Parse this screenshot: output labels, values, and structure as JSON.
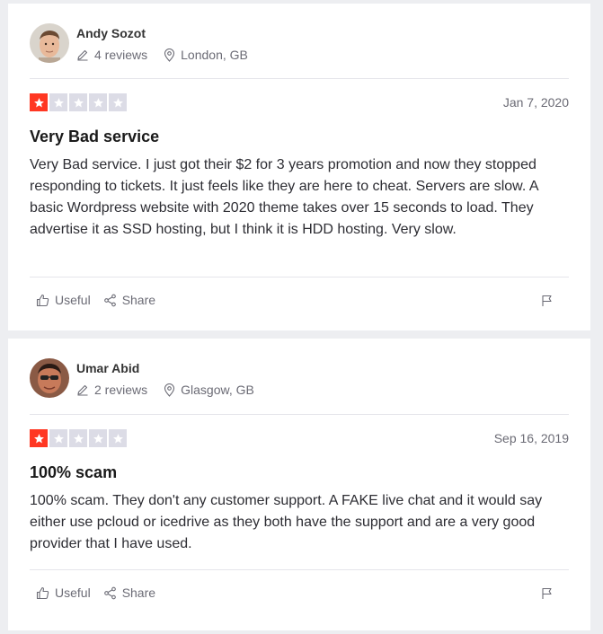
{
  "reviews": [
    {
      "author": "Andy Sozot",
      "review_count": "4 reviews",
      "location": "London, GB",
      "rating": 1,
      "rating_max": 5,
      "date": "Jan 7, 2020",
      "title": "Very Bad service",
      "text": "Very Bad service. I just got their $2 for 3 years promotion and now they stopped responding to tickets. It just feels like they are here to cheat. Servers are slow. A basic Wordpress website with 2020 theme takes over 15 seconds to load. They advertise it as SSD hosting, but I think it is HDD hosting. Very slow.",
      "useful_label": "Useful",
      "share_label": "Share"
    },
    {
      "author": "Umar Abid",
      "review_count": "2 reviews",
      "location": "Glasgow, GB",
      "rating": 1,
      "rating_max": 5,
      "date": "Sep 16, 2019",
      "title": "100% scam",
      "text": "100% scam. They don't any customer support. A FAKE live chat and it would say either use pcloud or icedrive as they both have the support and are a very good provider that I have used.",
      "useful_label": "Useful",
      "share_label": "Share"
    }
  ],
  "colors": {
    "star_on": "#ff3722",
    "star_off": "#dcdce6",
    "page_bg": "#edeef1"
  },
  "icons": [
    "pencil-icon",
    "location-pin-icon",
    "star-icon",
    "thumbs-up-icon",
    "share-icon",
    "flag-icon"
  ]
}
